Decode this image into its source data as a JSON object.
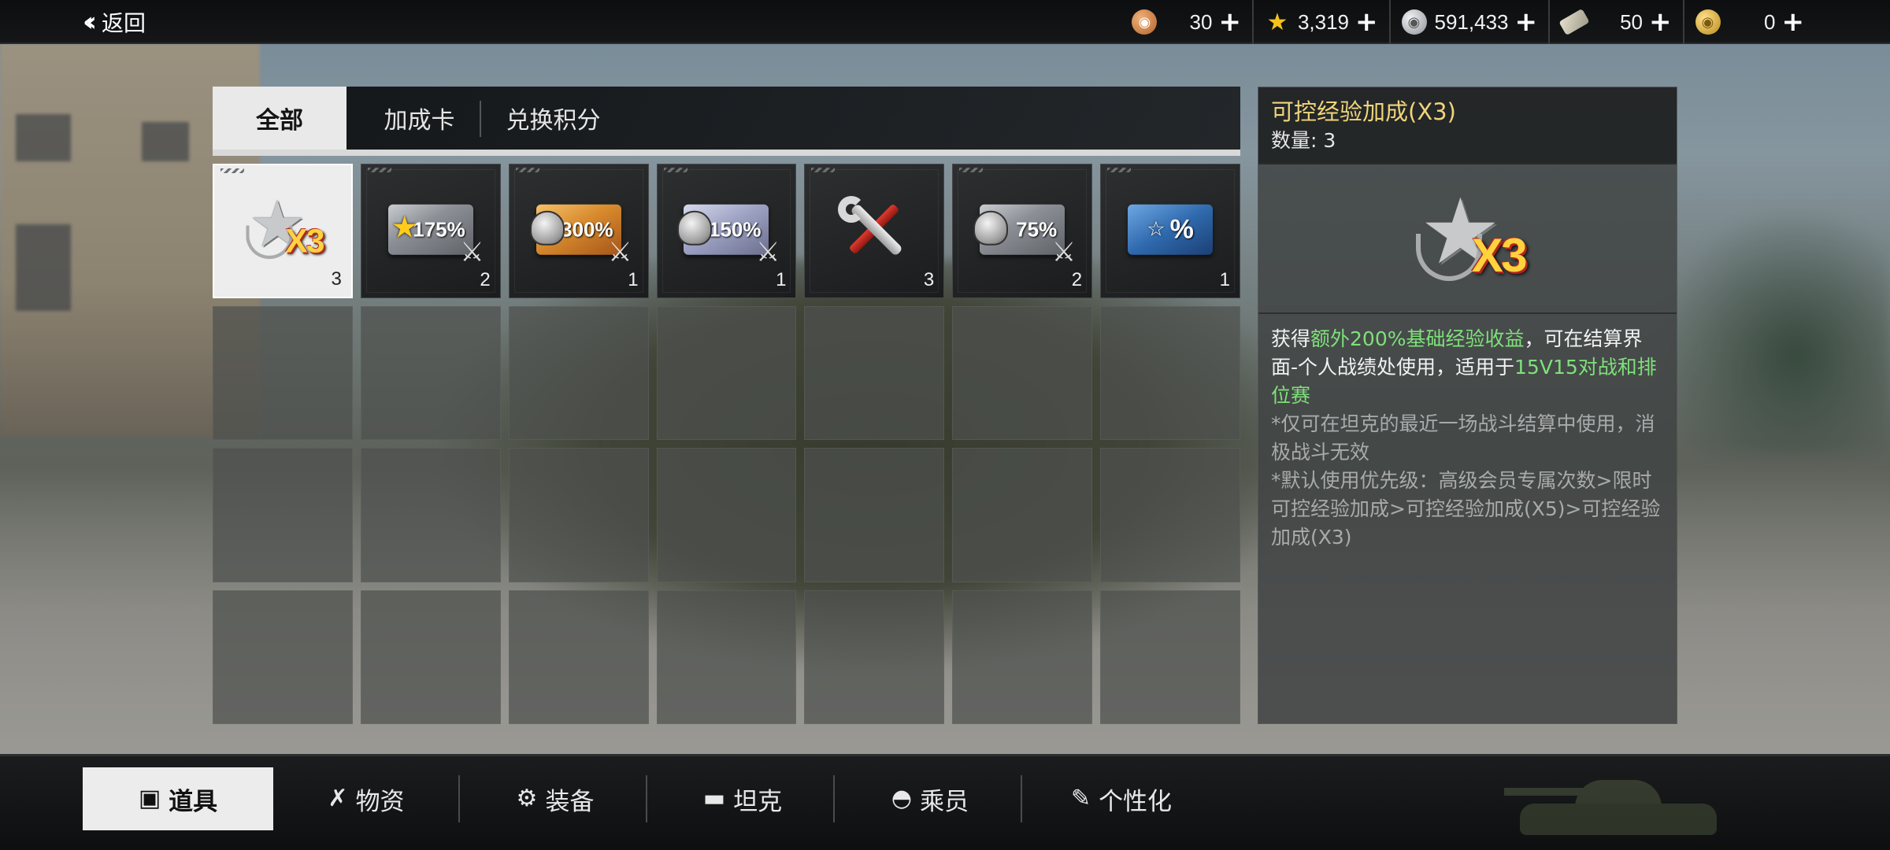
{
  "top_bar": {
    "back_label": "返回",
    "currencies": [
      {
        "icon": "bronze-coin-icon",
        "value": "30",
        "color": "#c77a3a"
      },
      {
        "icon": "gold-star-icon",
        "value": "3,319",
        "color": "#f5c21b"
      },
      {
        "icon": "silver-coin-icon",
        "value": "591,433",
        "color": "#b9bcc0"
      },
      {
        "icon": "ticket-icon",
        "value": "50",
        "color": "#c4bfae"
      },
      {
        "icon": "gold-coin-icon",
        "value": "0",
        "color": "#d9b23a"
      }
    ],
    "plus_glyph": "+"
  },
  "tabs": [
    {
      "label": "全部",
      "active": true
    },
    {
      "label": "加成卡",
      "active": false
    },
    {
      "label": "兑换积分",
      "active": false
    }
  ],
  "items": [
    {
      "name": "controllable-xp-boost-x3",
      "icon": "x3-star-badge-icon",
      "label": "X3",
      "qty": "3",
      "selected": true
    },
    {
      "name": "star-boost-175",
      "icon": "star-card-icon",
      "label": "175%",
      "qty": "2",
      "selected": false
    },
    {
      "name": "crew-boost-300",
      "icon": "helmet-card-gold-icon",
      "label": "300%",
      "qty": "1",
      "selected": false
    },
    {
      "name": "crew-boost-150",
      "icon": "helmet-card-lilac-icon",
      "label": "150%",
      "qty": "1",
      "selected": false
    },
    {
      "name": "repair-kit",
      "icon": "wrench-icon",
      "label": "",
      "qty": "3",
      "selected": false
    },
    {
      "name": "crew-boost-75",
      "icon": "helmet-card-silver-icon",
      "label": "75%",
      "qty": "2",
      "selected": false
    },
    {
      "name": "discount-card",
      "icon": "star-percent-card-icon",
      "label": "%",
      "qty": "1",
      "selected": false
    }
  ],
  "detail": {
    "title": "可控经验加成(X3)",
    "count": "数量: 3",
    "badge_text": "X3",
    "desc_pre": "获得",
    "desc_hl1": "额外200%基础经验收益",
    "desc_mid": "，可在结算界面-个人战绩处使用，适用于",
    "desc_hl2": "15V15对战和排位赛",
    "note1": "*仅可在坦克的最近一场战斗结算中使用，消极战斗无效",
    "note2": "*默认使用优先级：高级会员专属次数>限时可控经验加成>可控经验加成(X5)>可控经验加成(X3)"
  },
  "bottom_nav": [
    {
      "label": "道具",
      "icon": "chest-icon",
      "active": true
    },
    {
      "label": "物资",
      "icon": "tools-icon",
      "active": false
    },
    {
      "label": "装备",
      "icon": "gear-box-icon",
      "active": false
    },
    {
      "label": "坦克",
      "icon": "tank-icon",
      "active": false
    },
    {
      "label": "乘员",
      "icon": "helmet-icon",
      "active": false
    },
    {
      "label": "个性化",
      "icon": "brush-icon",
      "active": false
    }
  ]
}
